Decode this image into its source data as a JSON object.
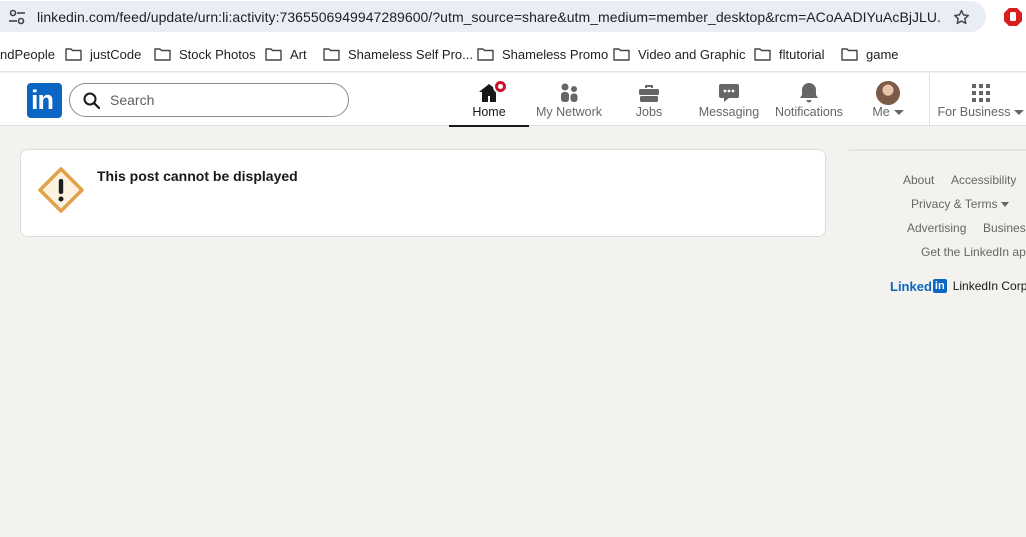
{
  "browser": {
    "url": "linkedin.com/feed/update/urn:li:activity:7365506949947289600/?utm_source=share&utm_medium=member_desktop&rcm=ACoAADIYuAcBjJLU...",
    "bookmarks": [
      {
        "label": "ndPeople",
        "folder": false
      },
      {
        "label": "justCode",
        "folder": true
      },
      {
        "label": "Stock Photos",
        "folder": true
      },
      {
        "label": "Art",
        "folder": true
      },
      {
        "label": "Shameless Self Pro...",
        "folder": true
      },
      {
        "label": "Shameless Promo",
        "folder": true
      },
      {
        "label": "Video and Graphic",
        "folder": true
      },
      {
        "label": "fltutorial",
        "folder": true
      },
      {
        "label": "game",
        "folder": true
      }
    ]
  },
  "linkedin": {
    "logo_text": "in",
    "search_placeholder": "Search",
    "nav": {
      "home": "Home",
      "network": "My Network",
      "jobs": "Jobs",
      "messaging": "Messaging",
      "notifications": "Notifications",
      "me": "Me",
      "business": "For Business"
    },
    "accent": "#0a66c2",
    "badge_color": "#cb112d"
  },
  "post": {
    "message": "This post cannot be displayed"
  },
  "footer": {
    "about": "About",
    "accessibility": "Accessibility",
    "privacy": "Privacy & Terms",
    "advertising": "Advertising",
    "business_services": "Business",
    "get_app": "Get the LinkedIn app",
    "brand_word": "Linked",
    "brand_box": "in",
    "corp": "LinkedIn Corporation"
  }
}
